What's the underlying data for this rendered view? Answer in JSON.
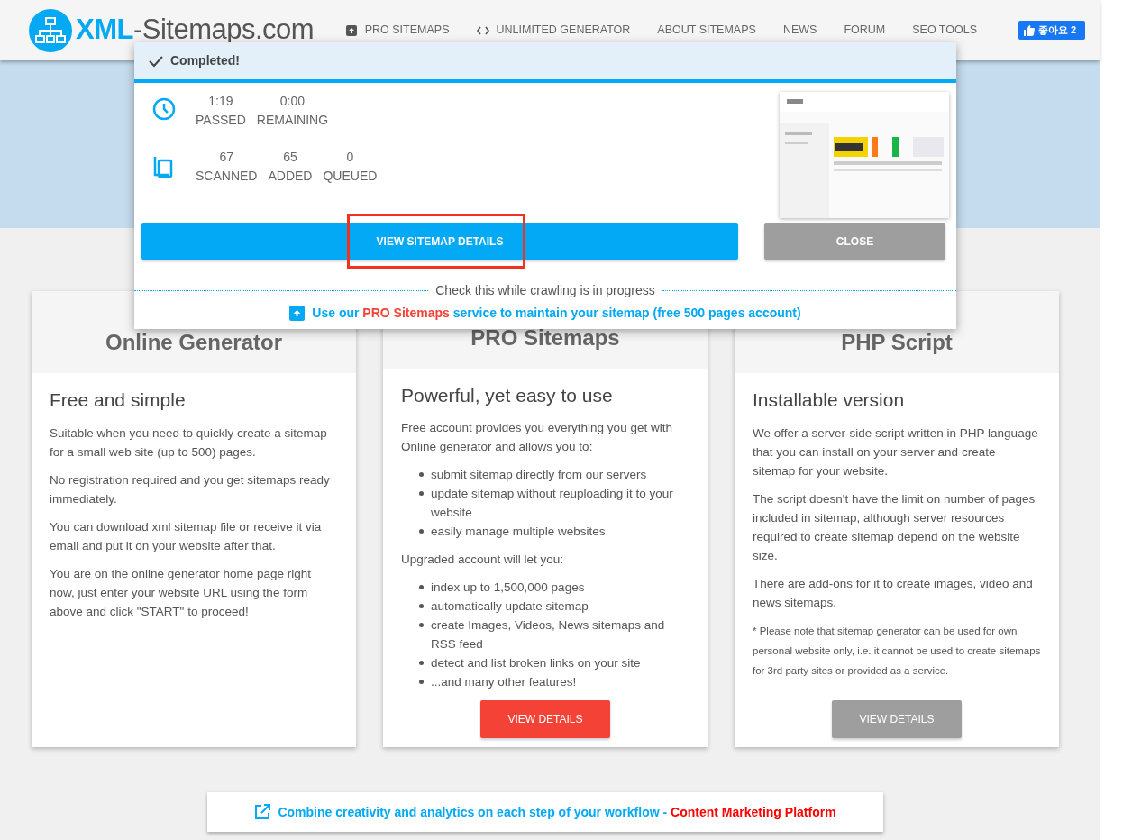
{
  "logo": {
    "bold": "XML",
    "rest": "-Sitemaps.com"
  },
  "nav": [
    {
      "label": "PRO SITEMAPS",
      "kind": "upload"
    },
    {
      "label": "UNLIMITED GENERATOR",
      "kind": "code"
    },
    {
      "label": "ABOUT SITEMAPS",
      "kind": "plain"
    },
    {
      "label": "NEWS",
      "kind": "plain"
    },
    {
      "label": "FORUM",
      "kind": "plain"
    },
    {
      "label": "SEO TOOLS",
      "kind": "plain"
    }
  ],
  "like_button": {
    "label": "좋아요 2"
  },
  "modal": {
    "title": "Completed!",
    "stats": [
      {
        "kind": "time",
        "items": [
          {
            "value": "1:19",
            "label": "PASSED"
          },
          {
            "value": "0:00",
            "label": "REMAINING"
          }
        ]
      },
      {
        "kind": "pages",
        "items": [
          {
            "value": "67",
            "label": "SCANNED"
          },
          {
            "value": "65",
            "label": "ADDED"
          },
          {
            "value": "0",
            "label": "QUEUED"
          }
        ]
      }
    ],
    "highlight": true,
    "buttons": [
      {
        "label": "VIEW SITEMAP DETAILS",
        "kind": "primary"
      },
      {
        "label": "CLOSE",
        "kind": "secondary"
      }
    ],
    "divider_text": "Check this while crawling is in progress",
    "promo": {
      "before": "Use our ",
      "link": "PRO Sitemaps",
      "after": " service to maintain your sitemap (free 500 pages account)"
    }
  },
  "cards": [
    {
      "title": "Online Generator",
      "subtitle": "Free and simple",
      "blocks": [
        {
          "kind": "p",
          "text": "Suitable when you need to quickly create a sitemap for a small web site (up to 500) pages."
        },
        {
          "kind": "p",
          "text": "No registration required and you get sitemaps ready immediately."
        },
        {
          "kind": "p",
          "text": "You can download xml sitemap file or receive it via email and put it on your website after that."
        },
        {
          "kind": "p",
          "text": "You are on the online generator home page right now, just enter your website URL using the form above and click \"START\" to proceed!"
        }
      ]
    },
    {
      "title": "PRO Sitemaps",
      "subtitle": "Powerful, yet easy to use",
      "blocks": [
        {
          "kind": "p",
          "text": "Free account provides you everything you get with Online generator and allows you to:"
        },
        {
          "kind": "list",
          "items": [
            "submit sitemap directly from our servers",
            "update sitemap without reuploading it to your website",
            "easily manage multiple websites"
          ]
        },
        {
          "kind": "p",
          "text": "Upgraded account will let you:"
        },
        {
          "kind": "list",
          "items": [
            "index up to 1,500,000 pages",
            "automatically update sitemap",
            "create Images, Videos, News sitemaps and RSS feed",
            "detect and list broken links on your site",
            "...and many other features!"
          ]
        }
      ],
      "button": {
        "label": "VIEW DETAILS",
        "color": "#f44336"
      }
    },
    {
      "title": "PHP Script",
      "subtitle": "Installable version",
      "blocks": [
        {
          "kind": "p",
          "text": "We offer a server-side script written in PHP language that you can install on your server and create sitemap for your website."
        },
        {
          "kind": "p",
          "text": "The script doesn't have the limit on number of pages included in sitemap, although server resources required to create sitemap depend on the website size."
        },
        {
          "kind": "p",
          "text": "There are add-ons for it to create images, video and news sitemaps."
        },
        {
          "kind": "note",
          "text": "* Please note that sitemap generator can be used for own personal website only, i.e. it cannot be used to create sitemaps for 3rd party sites or provided as a service."
        }
      ],
      "button": {
        "label": "VIEW DETAILS",
        "color": "#9e9e9e"
      }
    }
  ],
  "banner": {
    "text": "Combine creativity and analytics on each step of your workflow - ",
    "link": "Content Marketing Platform"
  }
}
